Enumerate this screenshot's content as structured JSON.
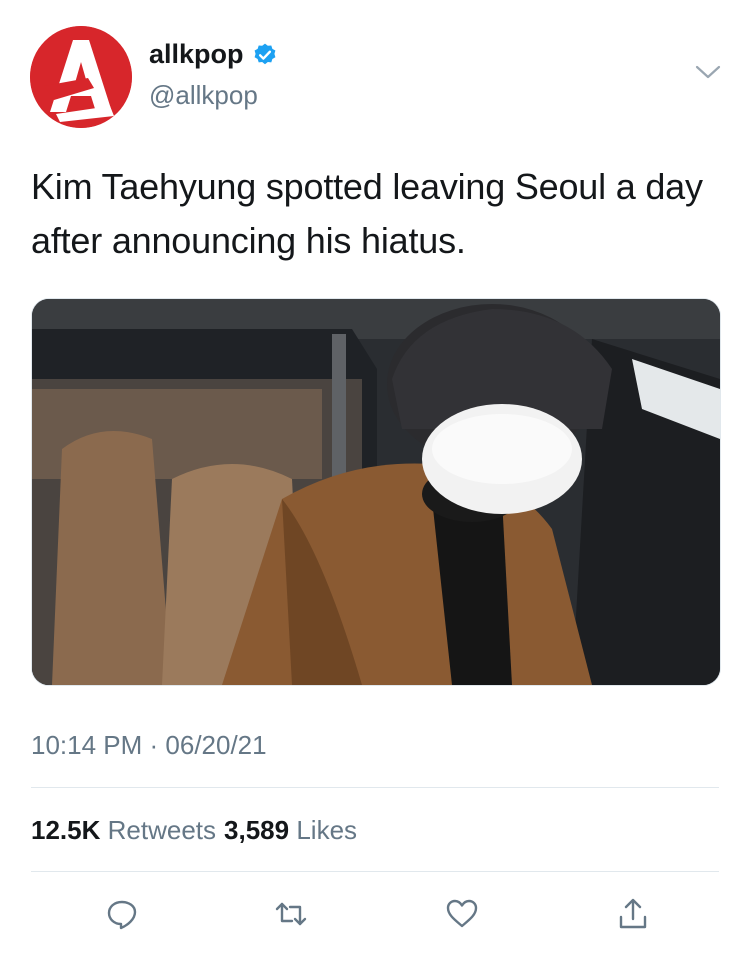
{
  "header": {
    "display_name": "allkpop",
    "handle": "@allkpop",
    "verified": true,
    "avatar_icon": "allkpop-logo",
    "menu_icon": "chevron-down-icon"
  },
  "tweet": {
    "text": "Kim Taehyung spotted leaving Seoul a day after announcing his hiatus.",
    "media_icon": "photo-person-leaving-car",
    "timestamp": "10:14 PM · 06/20/21"
  },
  "stats": {
    "retweets_count": "12.5K",
    "retweets_label": "Retweets",
    "likes_count": "3,589",
    "likes_label": "Likes"
  },
  "actions": [
    "reply-icon",
    "retweet-icon",
    "like-icon",
    "share-icon"
  ],
  "colors": {
    "brand_red": "#d7262b",
    "verified_blue": "#1da1f2",
    "secondary_text": "#657786",
    "divider": "#e1e8ed"
  }
}
